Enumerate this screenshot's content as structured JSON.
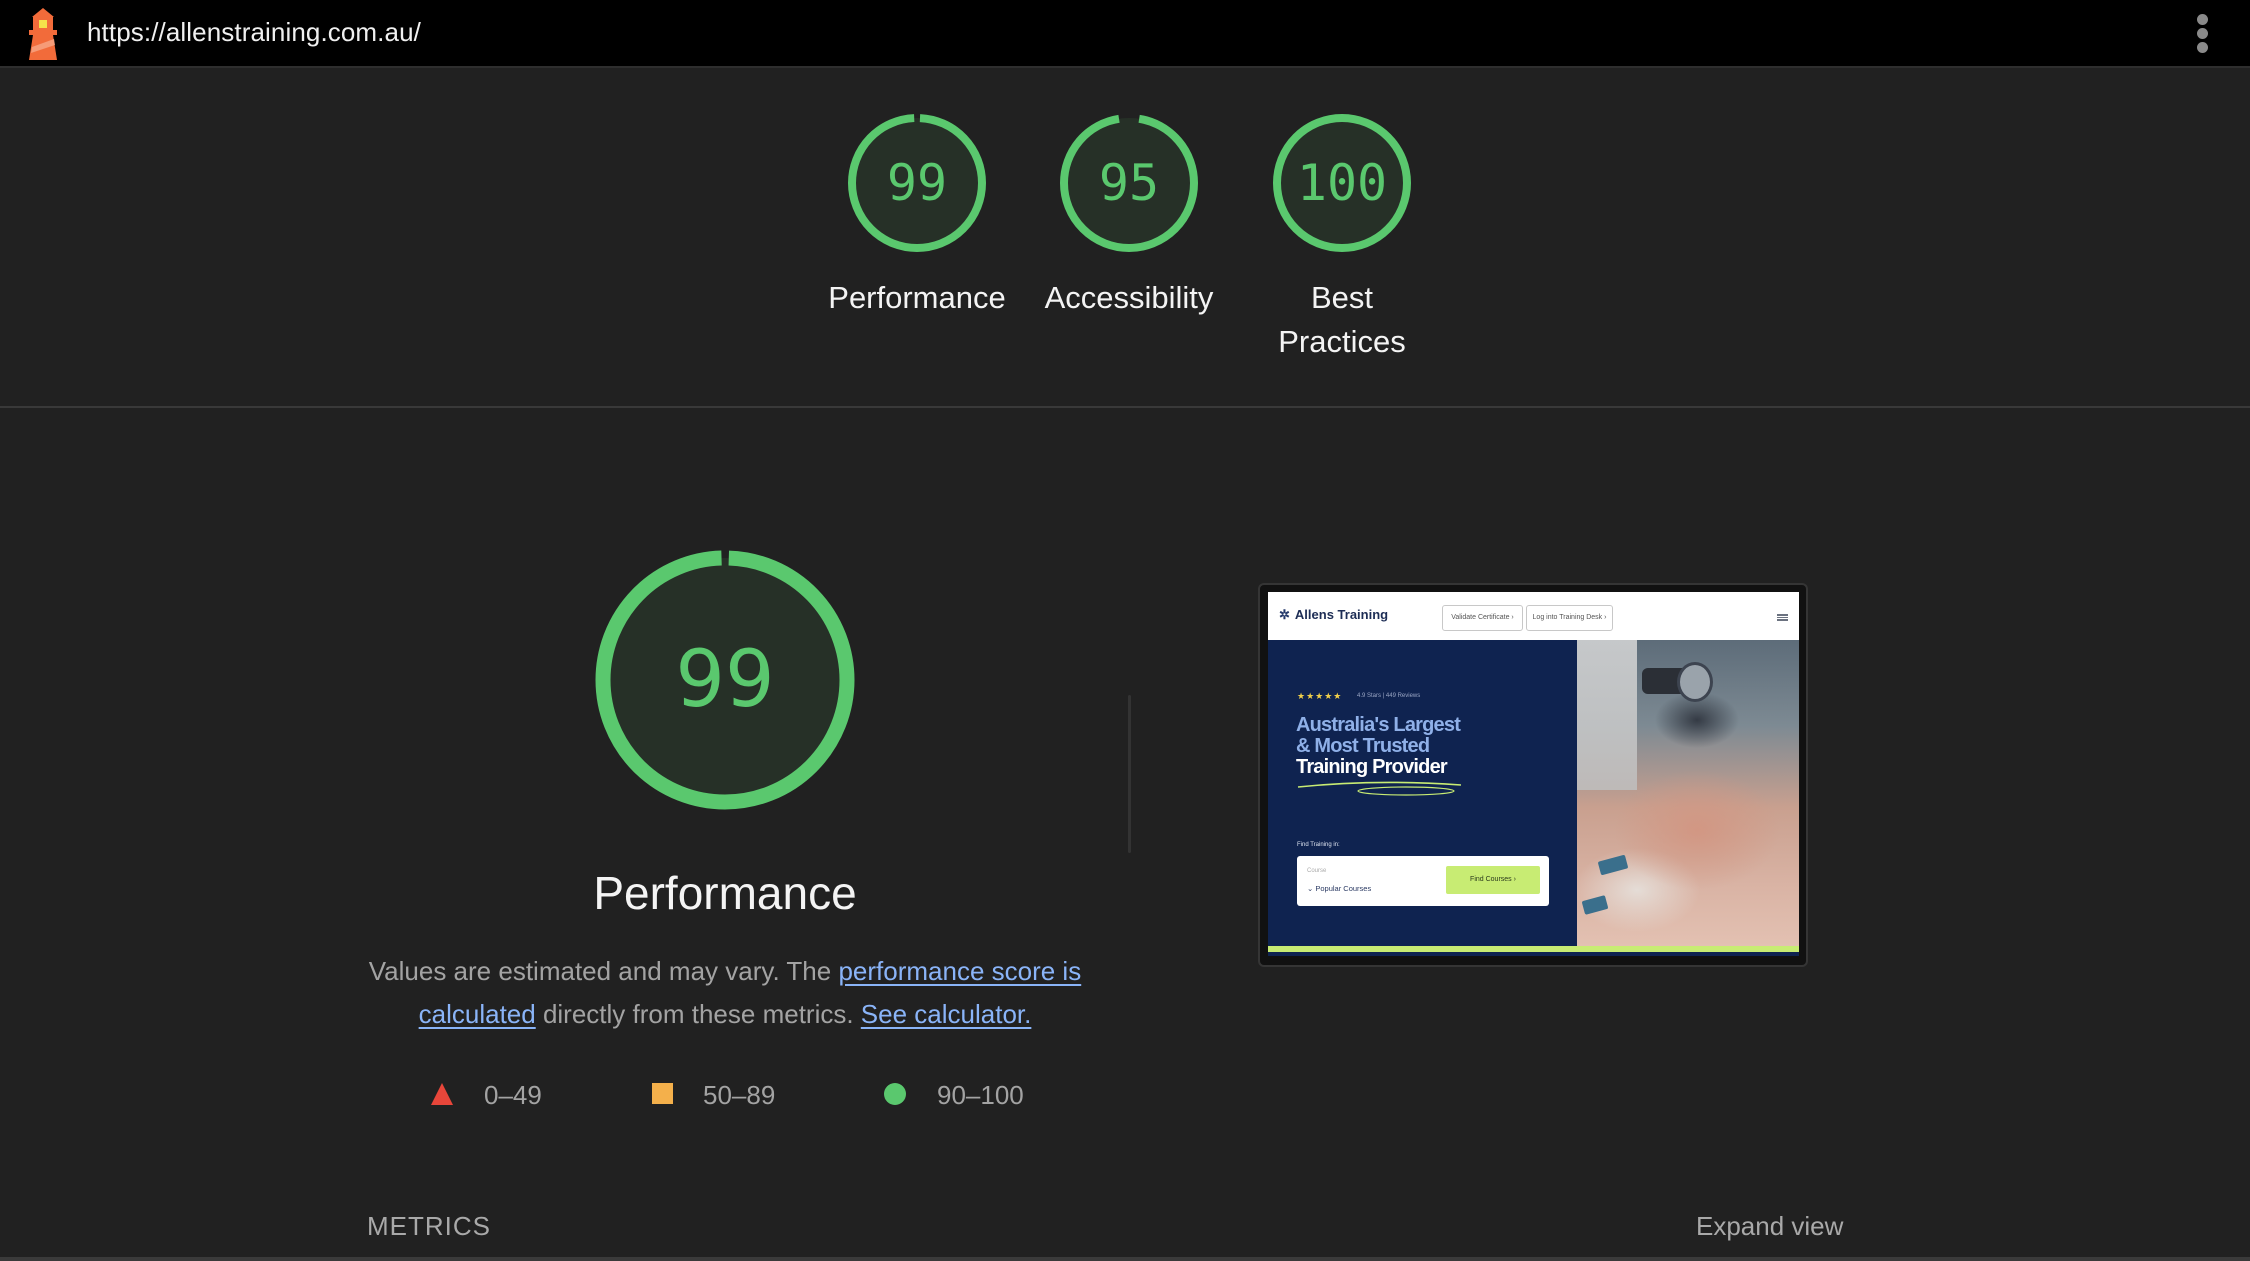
{
  "topbar": {
    "icon": "lighthouse-icon",
    "url": "https://allenstraining.com.au/",
    "menu_icon": "more-vert-icon"
  },
  "summary_gauges": [
    {
      "category": "Performance",
      "score": 99,
      "label_lines": [
        "Performance"
      ]
    },
    {
      "category": "Accessibility",
      "score": 95,
      "label_lines": [
        "Accessibility"
      ]
    },
    {
      "category": "Best Practices",
      "score": 100,
      "label_lines": [
        "Best",
        "Practices"
      ]
    }
  ],
  "colors": {
    "pass": "#5ac86e",
    "average": "#f4b04b",
    "fail": "#e8463a",
    "link": "#8ab4f8",
    "gauge_fill": "#263027"
  },
  "performance": {
    "score": 99,
    "title": "Performance",
    "desc_part1": "Values are estimated and may vary. The ",
    "link1": "performance score is calculated",
    "desc_part2": " directly from these metrics. ",
    "link2": "See calculator."
  },
  "legend": [
    {
      "shape": "triangle",
      "range": "0–49"
    },
    {
      "shape": "square",
      "range": "50–89"
    },
    {
      "shape": "circle",
      "range": "90–100"
    }
  ],
  "thumbnail": {
    "brand": "Allens Training",
    "nav_buttons": [
      "Validate Certificate ›",
      "Log into Training Desk ›"
    ],
    "stars": "★★★★★",
    "rating": "4.9 Stars  |  449 Reviews",
    "headline": [
      "Australia's Largest",
      "& Most Trusted",
      "Training Provider"
    ],
    "find_label": "Find Training in:",
    "course_label": "Course",
    "course_value": "⌄  Popular Courses",
    "find_button": "Find Courses ›"
  },
  "metrics": {
    "title": "METRICS",
    "expand_label": "Expand view"
  }
}
